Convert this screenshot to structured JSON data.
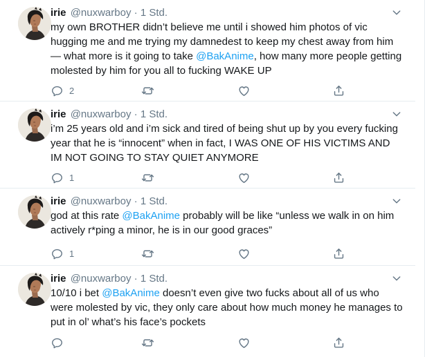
{
  "tweets": [
    {
      "name": "irie",
      "handle": "@nuxwarboy",
      "separator": "·",
      "time": "1 Std.",
      "text_before": "my own BROTHER didn’t believe me until i showed him photos of vic hugging me and me trying my damnedest to keep my chest away from him — what more is it going to take ",
      "mention": "@BakAnime",
      "text_after": ", how many more people getting molested by him for you all to fucking WAKE UP",
      "reply_count": "2"
    },
    {
      "name": "irie",
      "handle": "@nuxwarboy",
      "separator": "·",
      "time": "1 Std.",
      "text_before": "i’m 25 years old and i’m sick and tired of being shut up by you every fucking year that he is “innocent” when in fact, I WAS ONE OF HIS VICTIMS AND IM NOT GOING TO STAY QUIET ANYMORE",
      "mention": "",
      "text_after": "",
      "reply_count": "1"
    },
    {
      "name": "irie",
      "handle": "@nuxwarboy",
      "separator": "·",
      "time": "1 Std.",
      "text_before": "god at this rate ",
      "mention": "@BakAnime",
      "text_after": " probably will be like “unless we walk in on him actively r*ping a minor, he is in our good graces”",
      "reply_count": "1"
    },
    {
      "name": "irie",
      "handle": "@nuxwarboy",
      "separator": "·",
      "time": "1 Std.",
      "text_before": "10/10 i bet ",
      "mention": "@BakAnime",
      "text_after": " doesn’t even give two fucks about all of us who were molested by vic, they only care about how much money he manages to put in ol’ what’s his face’s pockets",
      "reply_count": ""
    }
  ],
  "icons": {
    "menu": "chevron-down-icon",
    "reply": "reply-icon",
    "retweet": "retweet-icon",
    "like": "heart-icon",
    "share": "share-icon"
  },
  "colors": {
    "text": "#14171a",
    "secondary": "#657786",
    "mention": "#1da1f2",
    "divider": "#e6ecf0",
    "icon": "#657786"
  }
}
